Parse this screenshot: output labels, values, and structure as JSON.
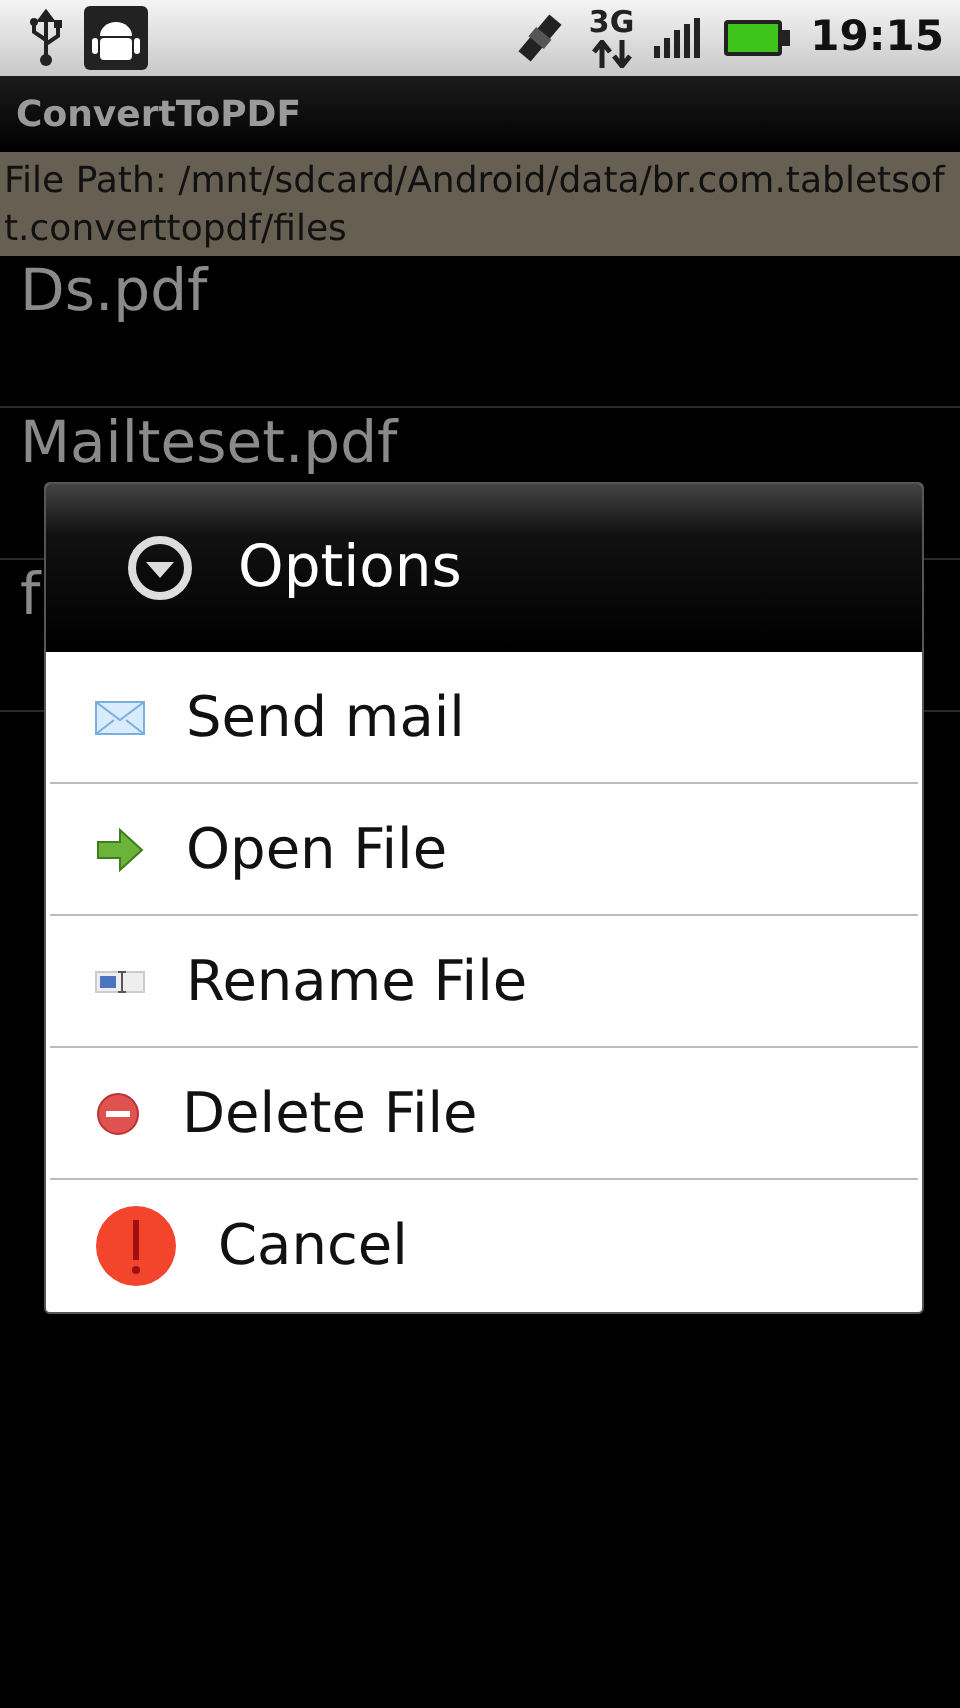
{
  "status_bar": {
    "time": "19:15",
    "network": "3G"
  },
  "app_title": "ConvertToPDF",
  "file_path": "File Path: /mnt/sdcard/Android/data/br.com.tabletsoft.converttopdf/files",
  "files": [
    {
      "name": "Ds.pdf"
    },
    {
      "name": "Mailteset.pdf"
    },
    {
      "name": "f"
    }
  ],
  "dialog": {
    "title": "Options",
    "items": [
      {
        "label": "Send mail",
        "kind": "mail"
      },
      {
        "label": "Open File",
        "kind": "open"
      },
      {
        "label": "Rename File",
        "kind": "rename"
      },
      {
        "label": "Delete File",
        "kind": "delete"
      },
      {
        "label": "Cancel",
        "kind": "cancel"
      }
    ]
  }
}
